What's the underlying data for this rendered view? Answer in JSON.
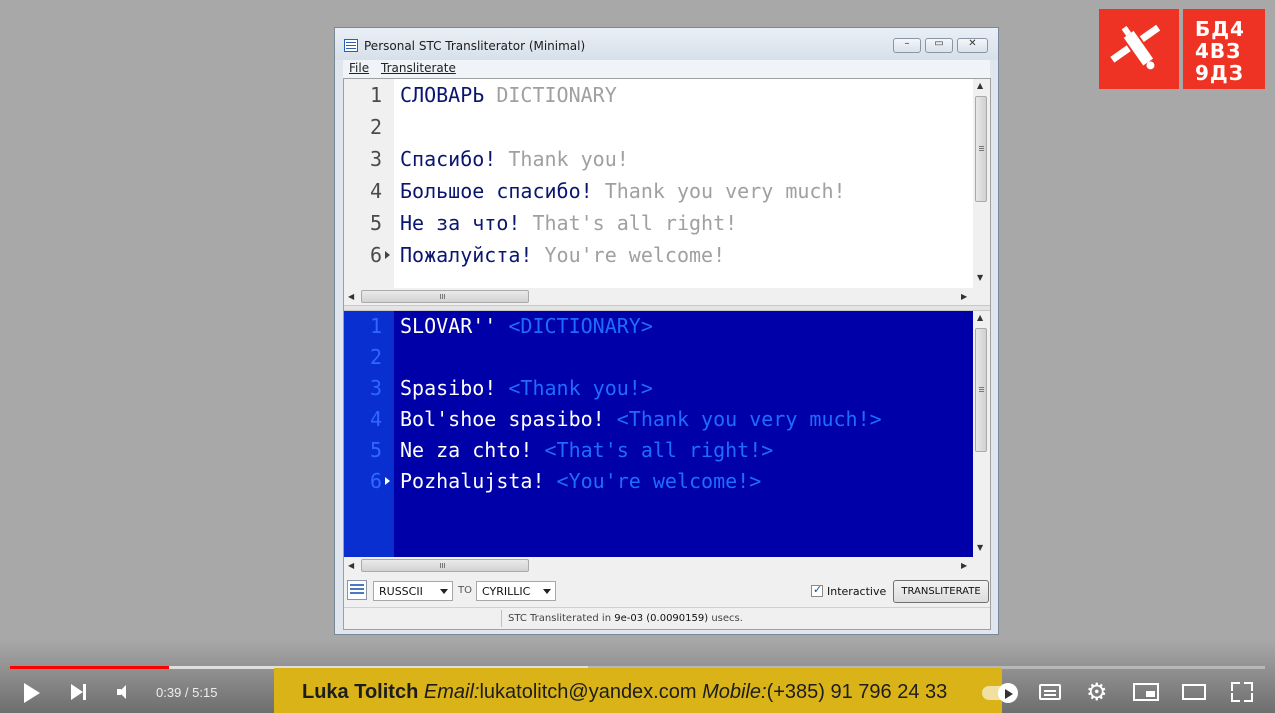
{
  "window": {
    "title": "Personal STC Transliterator (Minimal)",
    "buttons": {
      "minimize": "–",
      "maximize": "▭",
      "close": "✕"
    }
  },
  "menu": {
    "file": "File",
    "transliterate": "Transliterate"
  },
  "input_lines": [
    {
      "num": "1",
      "ru": "СЛОВАРЬ",
      "en": "DICTIONARY"
    },
    {
      "num": "2",
      "ru": "",
      "en": ""
    },
    {
      "num": "3",
      "ru": "Спасибо!",
      "en": "Thank you!"
    },
    {
      "num": "4",
      "ru": "Большое спасибо!",
      "en": "Thank you very much!"
    },
    {
      "num": "5",
      "ru": "Не за что!",
      "en": "That's all right!"
    },
    {
      "num": "6",
      "ru": "Пожалуйста!",
      "en": "You're welcome!"
    }
  ],
  "output_lines": [
    {
      "num": "1",
      "ru": "SLOVAR''",
      "en": "<DICTIONARY>"
    },
    {
      "num": "2",
      "ru": "",
      "en": ""
    },
    {
      "num": "3",
      "ru": "Spasibo!",
      "en": "<Thank you!>"
    },
    {
      "num": "4",
      "ru": "Bol'shoe spasibo!",
      "en": "<Thank you very much!>"
    },
    {
      "num": "5",
      "ru": "Ne za chto!",
      "en": "<That's all right!>"
    },
    {
      "num": "6",
      "ru": "Pozhalujsta!",
      "en": "<You're welcome!>"
    }
  ],
  "toolbar": {
    "from_value": "RUSSCII",
    "to_label": "TO",
    "to_value": "CYRILLIC",
    "interactive_label": "Interactive",
    "interactive_checked": true,
    "transliterate_button": "TRANSLITERATE"
  },
  "status": {
    "prefix": "STC Transliterated in",
    "time": "9e-03 (0.0090159)",
    "unit": "usecs."
  },
  "logo": {
    "text": "БД4 4ВЗ 9ДЗ"
  },
  "player": {
    "time": "0:39 / 5:15",
    "progress_fraction": 0.1263,
    "buffered_fraction": 0.4606
  },
  "banner": {
    "name": "Luka Tolitch",
    "email_label": "Email:",
    "email": "lukatolitch@yandex.com",
    "mobile_label": "Mobile:",
    "mobile": "(+385) 91 796 24 33"
  },
  "colors": {
    "input_ru": "#0a1570",
    "input_en": "#a0a0a0",
    "output_bg": "#0000a8",
    "output_ru": "#ffffff",
    "output_en": "#1e6cff",
    "progress": "#ff0000",
    "banner": "#d9b318",
    "logo": "#ee3324"
  }
}
